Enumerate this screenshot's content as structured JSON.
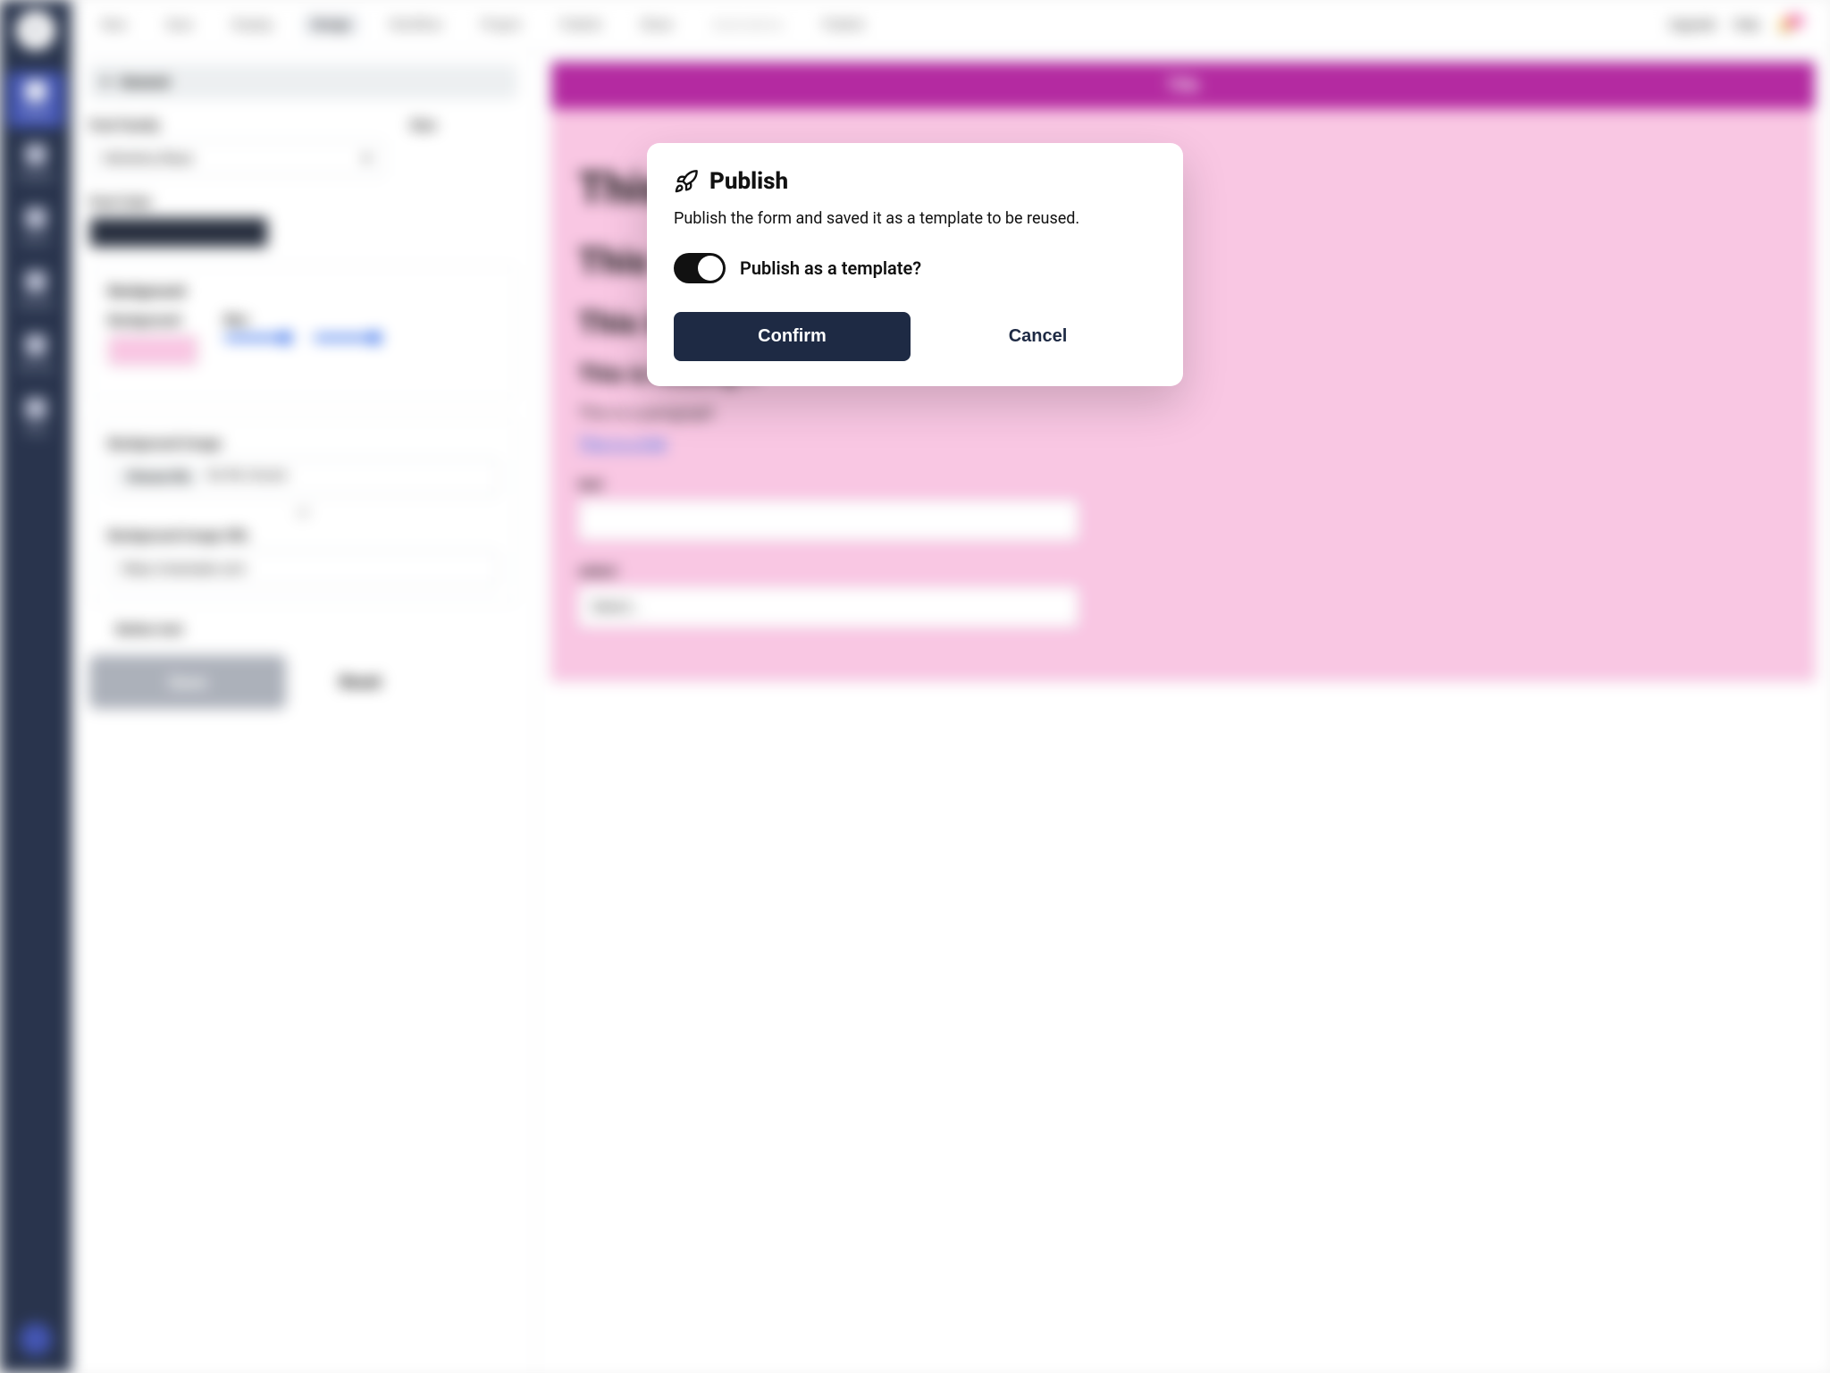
{
  "sidebar": {
    "items": [
      {
        "label": "Forms"
      },
      {
        "label": "Projects"
      },
      {
        "label": "Admin"
      },
      {
        "label": "General"
      },
      {
        "label": "My Org"
      },
      {
        "label": "Shop"
      }
    ]
  },
  "topbar": {
    "tabs": [
      "New",
      "Save",
      "Display",
      "Design",
      "Workflow",
      "Project",
      "Publish",
      "Share"
    ],
    "active_index": 3,
    "disabled_label": "Automations",
    "enabled_label": "Publish",
    "right": {
      "upgrade": "Upgrade",
      "help": "Help"
    }
  },
  "panel": {
    "section": "General",
    "font_family_label": "Font Family",
    "font_family_value": "Helvetica Neue",
    "size_label": "Size",
    "font_color_label": "Font Color",
    "background_group": "Background",
    "background_label": "Background",
    "blur_label": "Blur",
    "bg_image_label": "Background Image",
    "choose_file_label": "Choose file",
    "no_file_label": "No file chosen",
    "or_label": "or",
    "bg_image_url_label": "Background Image URL",
    "bg_image_url_value": "https://example.com",
    "button_text_label": "Button text",
    "save_label": "Save",
    "reset_label": "Reset"
  },
  "preview": {
    "title": "Title",
    "h1": "This is heading 1",
    "h2": "This is heading 2",
    "h3": "This is heading 3",
    "h4": "This is heading 4",
    "paragraph": "This is a paragraph",
    "link": "This is a link",
    "field_text_label": "text",
    "field_select_label": "select",
    "select_placeholder": "Select..."
  },
  "modal": {
    "title": "Publish",
    "message": "Publish the form and saved it as a template to be reused.",
    "toggle_label": "Publish as a template?",
    "confirm": "Confirm",
    "cancel": "Cancel"
  }
}
